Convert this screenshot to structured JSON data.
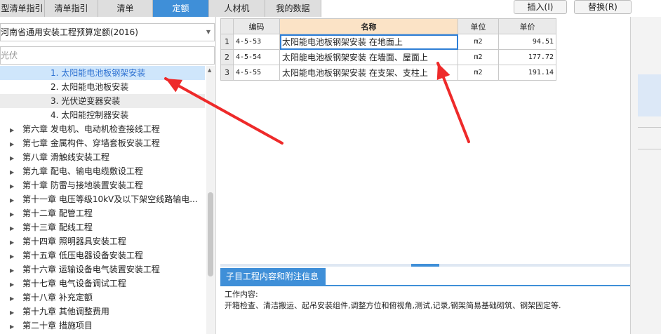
{
  "tabs": [
    "型清单指引",
    "清单指引",
    "清单",
    "定额",
    "人材机",
    "我的数据"
  ],
  "actions": {
    "insert": "插入(I)",
    "replace": "替换(R)"
  },
  "left": {
    "quota_library": "河南省通用安装工程预算定额(2016)",
    "search_text": "光伏",
    "sub_items": [
      "1. 太阳能电池板钢架安装",
      "2. 太阳能电池板安装",
      "3. 光伏逆变器安装",
      "4. 太阳能控制器安装"
    ],
    "chapters": [
      "第六章 发电机、电动机检查接线工程",
      "第七章 金属构件、穿墙套板安装工程",
      "第八章 滑触线安装工程",
      "第九章 配电、输电电缆敷设工程",
      "第十章 防雷与接地装置安装工程",
      "第十一章 电压等级10kV及以下架空线路输电...",
      "第十二章 配管工程",
      "第十三章 配线工程",
      "第十四章 照明器具安装工程",
      "第十五章 低压电器设备安装工程",
      "第十六章 运输设备电气装置安装工程",
      "第十七章 电气设备调试工程",
      "第十八章 补充定额",
      "第十九章 其他调整费用",
      "第二十章 措施项目"
    ]
  },
  "grid": {
    "headers": [
      "编码",
      "名称",
      "单位",
      "单价"
    ],
    "rows": [
      {
        "num": "1",
        "code": "4-5-53",
        "name": "太阳能电池板钢架安装 在地面上",
        "unit": "m2",
        "price": "94.51"
      },
      {
        "num": "2",
        "code": "4-5-54",
        "name": "太阳能电池板钢架安装 在墙面、屋面上",
        "unit": "m2",
        "price": "177.72"
      },
      {
        "num": "3",
        "code": "4-5-55",
        "name": "太阳能电池板钢架安装 在支架、支柱上",
        "unit": "m2",
        "price": "191.14"
      }
    ]
  },
  "detail": {
    "tab_label": "子目工程内容和附注信息",
    "work_label": "工作内容:",
    "work_text": "开箱检查、清洁搬运、起吊安装组件,调整方位和俯视角,测试,记录,钢架简易基础砌筑、钢架固定等."
  },
  "colors": {
    "accent": "#3f8fd8",
    "annotation_arrow": "#ee2a2a"
  },
  "icons": [
    "dropdown-arrow-icon",
    "tree-expand-icon",
    "scroll-up-icon",
    "splitter-handle-icon"
  ]
}
